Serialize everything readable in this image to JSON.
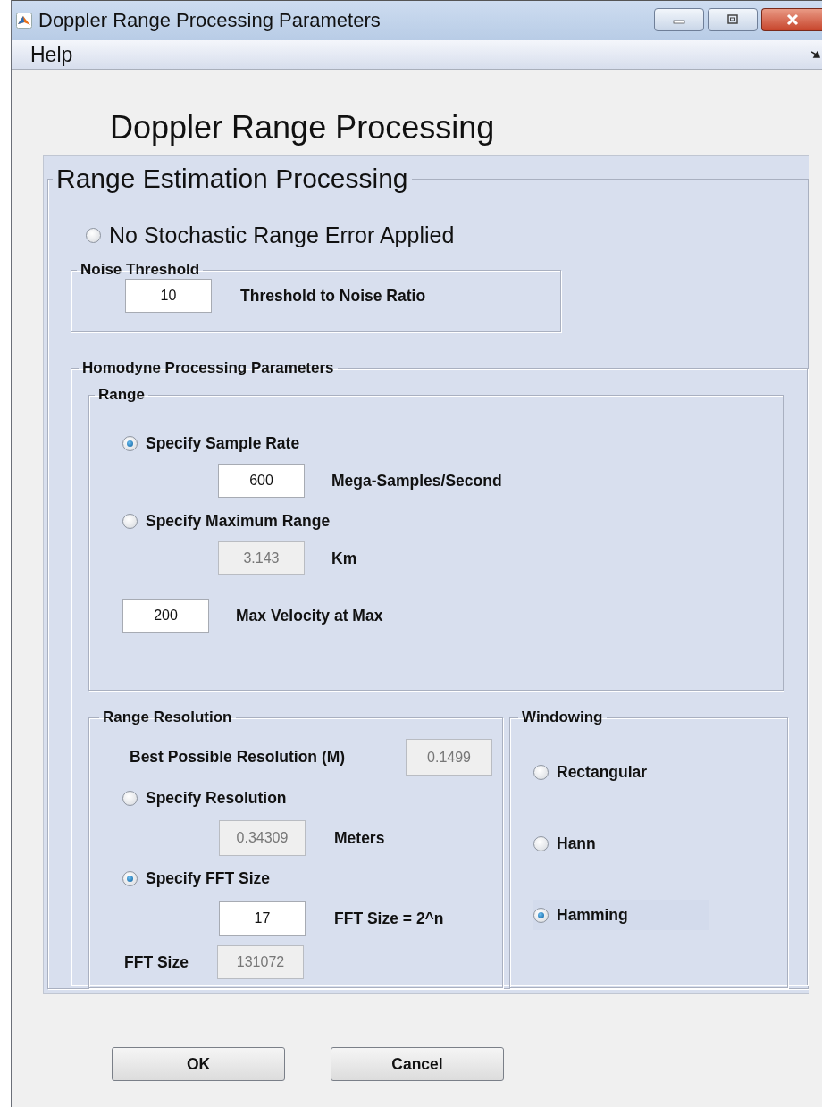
{
  "window": {
    "title": "Doppler Range Processing Parameters"
  },
  "menu": [
    {
      "label": "Help"
    }
  ],
  "heading": "Doppler Range Processing",
  "estimation": {
    "title": "Range Estimation Processing",
    "no_error": {
      "label": "No Stochastic Range Error Applied",
      "selected": false
    },
    "noise_threshold": {
      "title": "Noise Threshold",
      "value": "10",
      "label": "Threshold to Noise Ratio",
      "disabled": false
    }
  },
  "homodyne": {
    "title": "Homodyne Processing Parameters",
    "range": {
      "title": "Range",
      "options": [
        {
          "label": "Specify Sample Rate",
          "selected": true,
          "value": "600",
          "disabled": false,
          "unit": "Mega-Samples/Second"
        },
        {
          "label": "Specify Maximum Range",
          "selected": false,
          "value": "3.143",
          "disabled": true,
          "unit": "Km"
        }
      ],
      "velocity": {
        "value": "200",
        "label": "Max Velocity at Max",
        "disabled": false
      }
    },
    "resolution": {
      "title": "Range Resolution",
      "best": {
        "label": "Best Possible Resolution (M)",
        "value": "0.1499",
        "disabled": true
      },
      "options": [
        {
          "label": "Specify Resolution",
          "selected": false,
          "value": "0.34309",
          "disabled": true,
          "unit": "Meters"
        },
        {
          "label": "Specify FFT Size",
          "selected": true,
          "value": "17",
          "disabled": false,
          "unit": "FFT Size = 2^n"
        }
      ],
      "fft_size": {
        "label": "FFT Size",
        "value": "131072",
        "disabled": true
      }
    },
    "windowing": {
      "title": "Windowing",
      "options": [
        {
          "label": "Rectangular",
          "selected": false
        },
        {
          "label": "Hann",
          "selected": false
        },
        {
          "label": "Hamming",
          "selected": true
        }
      ]
    }
  },
  "buttons": [
    {
      "label": "OK"
    },
    {
      "label": "Cancel"
    }
  ]
}
